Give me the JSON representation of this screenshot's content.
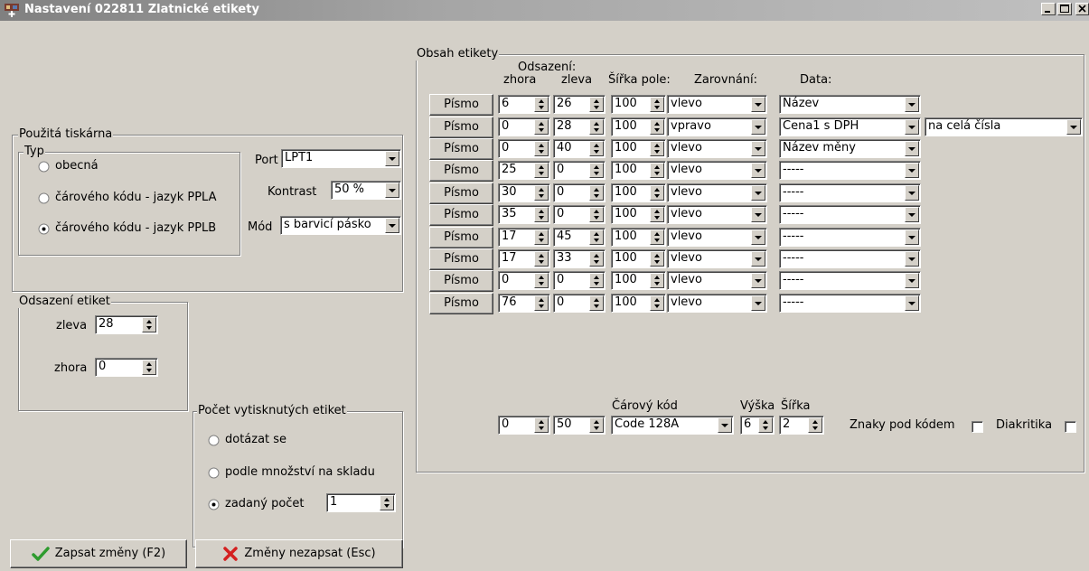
{
  "window": {
    "title": "Nastavení 022811 Zlatnické etikety",
    "app_icon": "app-icon",
    "controls": [
      "minimize",
      "maximize",
      "close"
    ]
  },
  "printer": {
    "group_label": "Použitá tiskárna",
    "type_label": "Typ",
    "types": [
      {
        "label": "obecná",
        "selected": false
      },
      {
        "label": "čárového kódu - jazyk PPLA",
        "selected": false
      },
      {
        "label": "čárového kódu - jazyk PPLB",
        "selected": true
      }
    ],
    "port_label": "Port",
    "port_value": "LPT1",
    "contrast_label": "Kontrast",
    "contrast_value": "50 %",
    "mode_label": "Mód",
    "mode_value": "s barvicí pásko"
  },
  "label_offset": {
    "group_label": "Odsazení etiket",
    "left_label": "zleva",
    "left_value": "28",
    "top_label": "zhora",
    "top_value": "0"
  },
  "print_count": {
    "group_label": "Počet vytisknutých etiket",
    "options": [
      {
        "label": "dotázat se",
        "selected": false
      },
      {
        "label": "podle množství na skladu",
        "selected": false
      },
      {
        "label": "zadaný počet",
        "selected": true
      }
    ],
    "count_value": "1"
  },
  "content": {
    "group_label": "Obsah etikety",
    "headers": {
      "offset": "Odsazení:",
      "top": "zhora",
      "left": "zleva",
      "width": "Šířka pole:",
      "align": "Zarovnání:",
      "data": "Data:"
    },
    "font_button_label": "Písmo",
    "rows": [
      {
        "top": "6",
        "left": "26",
        "width": "100",
        "align": "vlevo",
        "data": "Název"
      },
      {
        "top": "0",
        "left": "28",
        "width": "100",
        "align": "vpravo",
        "data": "Cena1 s DPH",
        "extra": "na celá čísla"
      },
      {
        "top": "0",
        "left": "40",
        "width": "100",
        "align": "vlevo",
        "data": "Název měny"
      },
      {
        "top": "25",
        "left": "0",
        "width": "100",
        "align": "vlevo",
        "data": "-----"
      },
      {
        "top": "30",
        "left": "0",
        "width": "100",
        "align": "vlevo",
        "data": "-----"
      },
      {
        "top": "35",
        "left": "0",
        "width": "100",
        "align": "vlevo",
        "data": "-----"
      },
      {
        "top": "17",
        "left": "45",
        "width": "100",
        "align": "vlevo",
        "data": "-----"
      },
      {
        "top": "17",
        "left": "33",
        "width": "100",
        "align": "vlevo",
        "data": "-----"
      },
      {
        "top": "0",
        "left": "0",
        "width": "100",
        "align": "vlevo",
        "data": "-----"
      },
      {
        "top": "76",
        "left": "0",
        "width": "100",
        "align": "vlevo",
        "data": "-----"
      }
    ],
    "barcode": {
      "type_label": "Čárový kód",
      "height_label": "Výška",
      "width_label": "Šířka",
      "top": "0",
      "left": "50",
      "type": "Code 128A",
      "height": "6",
      "width": "2",
      "chars_under_label": "Znaky pod kódem",
      "chars_under_checked": false,
      "diacritics_label": "Diakritika",
      "diacritics_checked": false
    }
  },
  "buttons": {
    "save_label": "Zapsat změny (F2)",
    "save_icon": "check-icon",
    "cancel_label": "Změny nezapsat (Esc)",
    "cancel_icon": "cross-icon"
  },
  "colors": {
    "face": "#d4d0c8",
    "check": "#2e9b2e",
    "cross": "#d42020"
  }
}
